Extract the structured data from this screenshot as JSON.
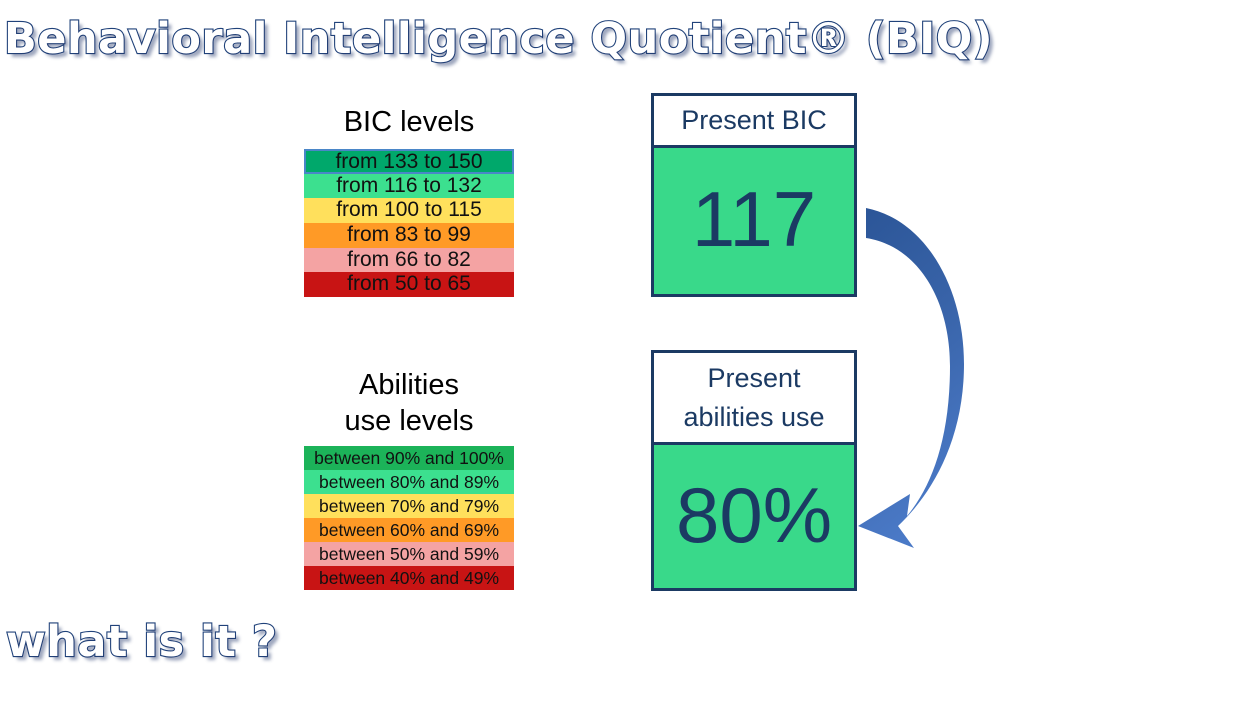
{
  "slide": {
    "title": "Behavioral Intelligence Quotient® (BIQ)",
    "question": "what is it ?",
    "background_color": "#ffffff"
  },
  "colors": {
    "title_fill": "#ffffff",
    "title_outline": "#20427a",
    "box_border": "#1b3a63",
    "box_text": "#1b3a63",
    "value_background": "#39d98a",
    "arrow_start": "#2b5597",
    "arrow_end": "#4472c4",
    "highlight_border": "#4a86c8"
  },
  "bic_levels": {
    "caption": "BIC levels",
    "rows": [
      {
        "label": "from 133 to 150",
        "color": "#00a86b",
        "highlighted": true
      },
      {
        "label": "from 116 to 132",
        "color": "#3ce08f",
        "highlighted": false
      },
      {
        "label": "from 100 to 115",
        "color": "#ffe05c",
        "highlighted": false
      },
      {
        "label": "from 83 to 99",
        "color": "#ff9a26",
        "highlighted": false
      },
      {
        "label": "from 66 to 82",
        "color": "#f4a3a3",
        "highlighted": false
      },
      {
        "label": "from 50 to 65",
        "color": "#c81414",
        "highlighted": false
      }
    ]
  },
  "abilities_levels": {
    "caption": "Abilities\nuse levels",
    "caption_line1": "Abilities",
    "caption_line2": "use levels",
    "rows": [
      {
        "label": "between 90% and 100%",
        "color": "#1cb359"
      },
      {
        "label": "between 80% and 89%",
        "color": "#3ce08f"
      },
      {
        "label": "between 70% and 79%",
        "color": "#ffe05c"
      },
      {
        "label": "between 60% and 69%",
        "color": "#ff9a26"
      },
      {
        "label": "between 50% and 59%",
        "color": "#f4a3a3"
      },
      {
        "label": "between 40% and 49%",
        "color": "#c81414"
      }
    ]
  },
  "metrics": [
    {
      "header": "Present BIC",
      "value": "117"
    },
    {
      "header": "Present\nabilities use",
      "value": "80%"
    }
  ],
  "arrow": {
    "name": "curved-flow-arrow",
    "direction": "from Present BIC down to Present abilities use"
  }
}
